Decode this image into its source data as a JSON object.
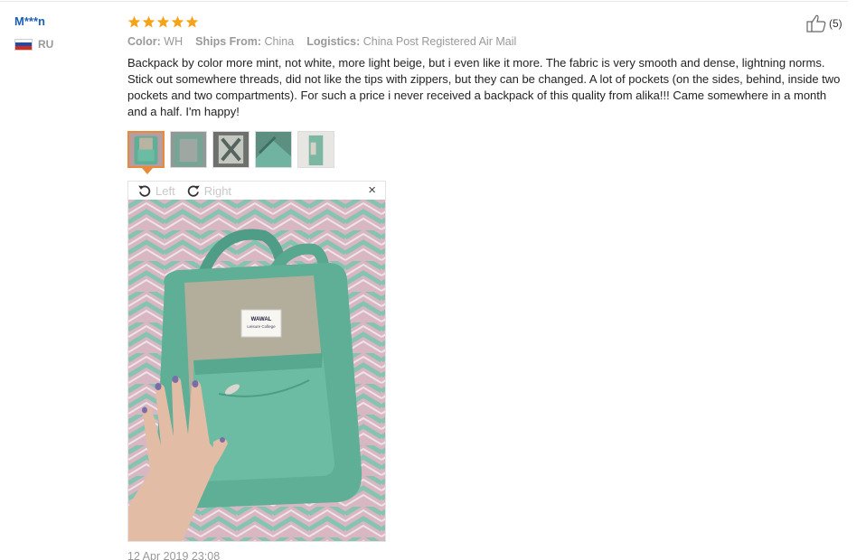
{
  "reviewer": {
    "name": "M***n",
    "country_code": "RU",
    "flag_colors": [
      "#ffffff",
      "#1c4ea8",
      "#d52b1e"
    ]
  },
  "review": {
    "rating": 5,
    "rating_color": "#f7a21b",
    "meta": [
      {
        "label": "Color:",
        "value": "WH"
      },
      {
        "label": "Ships From:",
        "value": "China"
      },
      {
        "label": "Logistics:",
        "value": "China Post Registered Air Mail"
      }
    ],
    "text": "Backpack by color more mint, not white, more light beige, but i even like it more. The fabric is very smooth and dense, lightning norms. Stick out somewhere threads, did not like the tips with zippers, but they can be changed. A lot of pockets (on the sides, behind, inside two pockets and two compartments). For such a price i never received a backpack of this quality from alika!!! Came somewhere in a month and a half. I'm happy!",
    "date": "12 Apr 2019 23:08",
    "helpful_count": "(5)"
  },
  "images": {
    "count": 5,
    "selected_index": 0
  },
  "viewer": {
    "rotate_left_label": "Left",
    "rotate_right_label": "Right",
    "close_label": "×",
    "tag_brand": "WAWAL",
    "tag_line": "Leisure College"
  }
}
